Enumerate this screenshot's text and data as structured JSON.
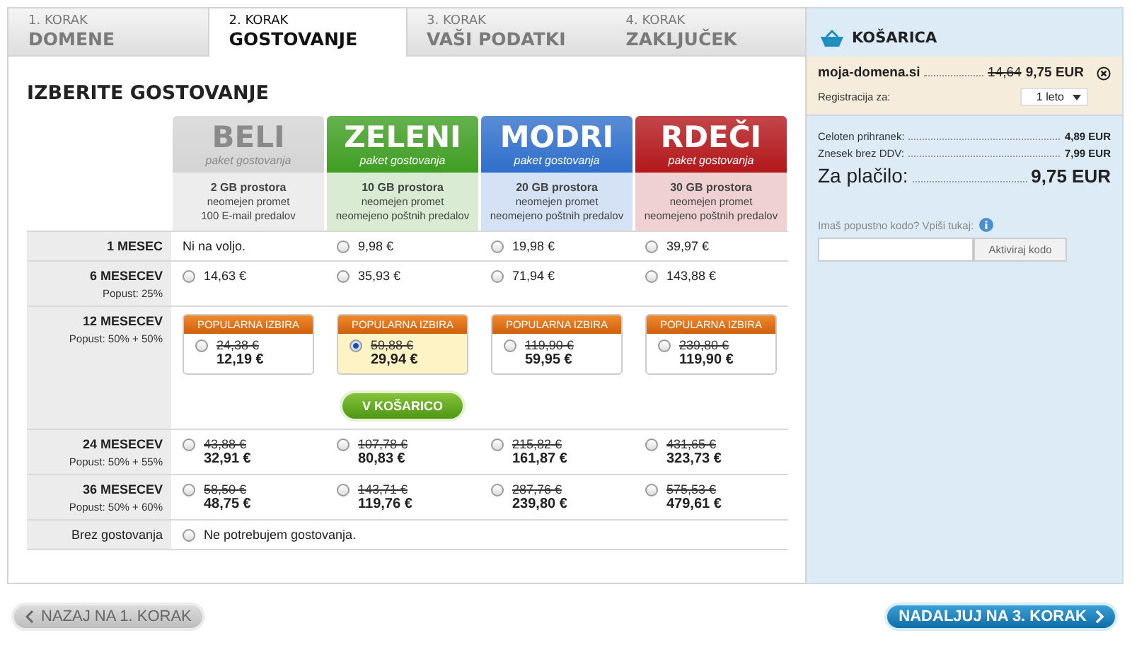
{
  "tabs": [
    {
      "step": "1. KORAK",
      "title": "DOMENE",
      "selected": false
    },
    {
      "step": "2. KORAK",
      "title": "GOSTOVANJE",
      "selected": true
    },
    {
      "step": "3. KORAK",
      "title": "VAŠI PODATKI",
      "selected": false
    },
    {
      "step": "4. KORAK",
      "title": "ZAKLJUČEK",
      "selected": false
    }
  ],
  "heading": "IZBERITE GOSTOVANJE",
  "plans": [
    {
      "name": "BELI",
      "subtitle": "paket gostovanja",
      "color": "#d4d4d4",
      "features": [
        "2 GB prostora",
        "neomejen promet",
        "100 E-mail predalov"
      ]
    },
    {
      "name": "ZELENI",
      "subtitle": "paket gostovanja",
      "color": "#3f9e22",
      "features": [
        "10 GB prostora",
        "neomejen promet",
        "neomejeno poštnih predalov"
      ]
    },
    {
      "name": "MODRI",
      "subtitle": "paket gostovanja",
      "color": "#2f6fcb",
      "features": [
        "20 GB prostora",
        "neomejen promet",
        "neomejeno poštnih predalov"
      ]
    },
    {
      "name": "RDEČI",
      "subtitle": "paket gostovanja",
      "color": "#b3181b",
      "features": [
        "30 GB prostora",
        "neomejen promet",
        "neomejeno poštnih predalov"
      ]
    }
  ],
  "rows": [
    {
      "kind": "plain",
      "label": "1 MESEC",
      "cells": [
        {
          "kind": "text",
          "text": "Ni na voljo."
        },
        {
          "kind": "option",
          "price": "9,98 €",
          "selected": false
        },
        {
          "kind": "option",
          "price": "19,98 €",
          "selected": false
        },
        {
          "kind": "option",
          "price": "39,97 €",
          "selected": false
        }
      ]
    },
    {
      "kind": "plain",
      "label": "6 MESECEV",
      "discount": "Popust: 25%",
      "cells": [
        {
          "kind": "option",
          "price": "14,63 €",
          "selected": false
        },
        {
          "kind": "option",
          "price": "35,93 €",
          "selected": false
        },
        {
          "kind": "option",
          "price": "71,94 €",
          "selected": false
        },
        {
          "kind": "option",
          "price": "143,88 €",
          "selected": false
        }
      ]
    },
    {
      "kind": "popular",
      "label": "12 MESECEV",
      "discount": "Popust: 50% + 50%",
      "button": "V KOŠARICO",
      "cells": [
        {
          "kind": "offer",
          "badge": "POPULARNA IZBIRA",
          "old": "24,38 €",
          "price": "12,19 €",
          "selected": false
        },
        {
          "kind": "offer",
          "badge": "POPULARNA IZBIRA",
          "old": "59,88 €",
          "price": "29,94 €",
          "selected": true
        },
        {
          "kind": "offer",
          "badge": "POPULARNA IZBIRA",
          "old": "119,90 €",
          "price": "59,95 €",
          "selected": false
        },
        {
          "kind": "offer",
          "badge": "POPULARNA IZBIRA",
          "old": "239,80 €",
          "price": "119,90 €",
          "selected": false
        }
      ]
    },
    {
      "kind": "plain",
      "label": "24 MESECEV",
      "discount": "Popust: 50% + 55%",
      "cells": [
        {
          "kind": "offer",
          "old": "43,88 €",
          "price": "32,91 €",
          "selected": false
        },
        {
          "kind": "offer",
          "old": "107,78 €",
          "price": "80,83 €",
          "selected": false
        },
        {
          "kind": "offer",
          "old": "215,82 €",
          "price": "161,87 €",
          "selected": false
        },
        {
          "kind": "offer",
          "old": "431,65 €",
          "price": "323,73 €",
          "selected": false
        }
      ]
    },
    {
      "kind": "plain",
      "label": "36 MESECEV",
      "discount": "Popust: 50% + 60%",
      "cells": [
        {
          "kind": "offer",
          "old": "58,50 €",
          "price": "48,75 €",
          "selected": false
        },
        {
          "kind": "offer",
          "old": "143,71 €",
          "price": "119,76 €",
          "selected": false
        },
        {
          "kind": "offer",
          "old": "287,76 €",
          "price": "239,80 €",
          "selected": false
        },
        {
          "kind": "offer",
          "old": "575,53 €",
          "price": "479,61 €",
          "selected": false
        }
      ]
    },
    {
      "kind": "full",
      "label": "Brez gostovanja",
      "cells": [
        {
          "kind": "option",
          "price": "Ne potrebujem gostovanja.",
          "selected": false
        }
      ]
    }
  ],
  "cart": {
    "title": "KOŠARICA",
    "item": {
      "domain": "moja-domena.si",
      "old": "14,64",
      "price": "9,75 EUR"
    },
    "registration": {
      "label": "Registracija za:",
      "value": "1 leto"
    },
    "summary": [
      {
        "label": "Celoten prihranek:",
        "value": "4,89 EUR"
      },
      {
        "label": "Znesek brez DDV:",
        "value": "7,99 EUR"
      }
    ],
    "total": {
      "label": "Za plačilo:",
      "value": "9,75 EUR"
    },
    "coupon": {
      "label": "Imaš popustno kodo? Vpiši tukaj:",
      "button": "Aktiviraj kodo"
    }
  },
  "nav": {
    "back": "NAZAJ NA 1. KORAK",
    "next": "NADALJUJ NA 3. KORAK"
  }
}
